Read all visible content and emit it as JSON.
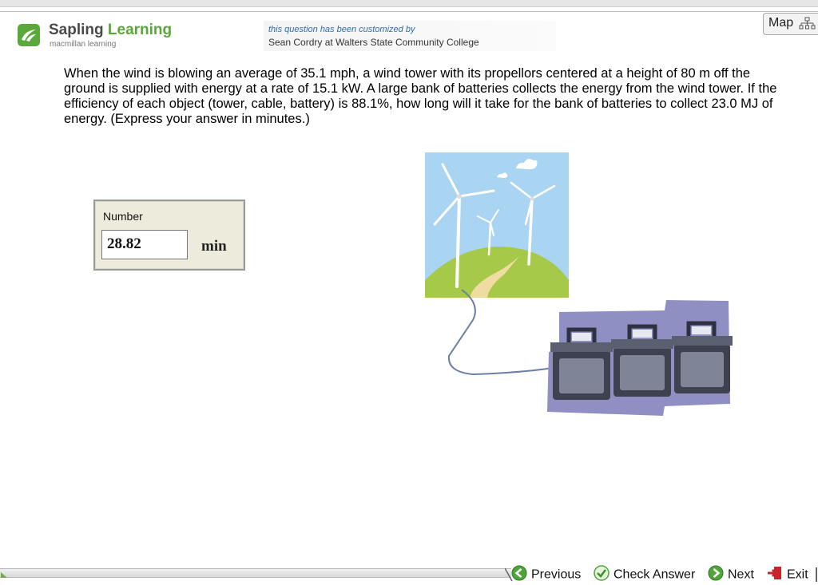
{
  "header": {
    "brand_name_part1": "Sapling ",
    "brand_name_part2": "Learning",
    "brand_sub": "macmillan learning",
    "customized_line1": "this question has been customized by",
    "customized_line2": "Sean Cordry at Walters State Community College",
    "map_label": "Map"
  },
  "question": {
    "text": "When the wind is blowing an average of 35.1 mph, a wind tower with its propellors centered at a height of 80 m off the ground is supplied with energy at a rate of  15.1 kW.  A large bank of batteries collects the energy from the wind tower.  If the efficiency of each object (tower, cable, battery) is 88.1%, how long will it take for the bank of batteries to collect 23.0 MJ of energy.  (Express your answer in minutes.)"
  },
  "answer": {
    "label": "Number",
    "value": "28.82",
    "unit": "min"
  },
  "toolbar": {
    "previous_label": "Previous",
    "check_label": "Check Answer",
    "next_label": "Next",
    "exit_label": "Exit"
  },
  "colors": {
    "brand_green": "#5aa83c",
    "sky": "#a9d4f2",
    "hill": "#a7c94a",
    "battery_bg": "#8f8fc4"
  },
  "icons": {
    "logo": "sapling-leaf-icon",
    "map": "map-tree-icon",
    "previous": "arrow-left-circle-icon",
    "check": "checkmark-circle-icon",
    "next": "arrow-right-circle-icon",
    "exit": "exit-door-icon"
  }
}
